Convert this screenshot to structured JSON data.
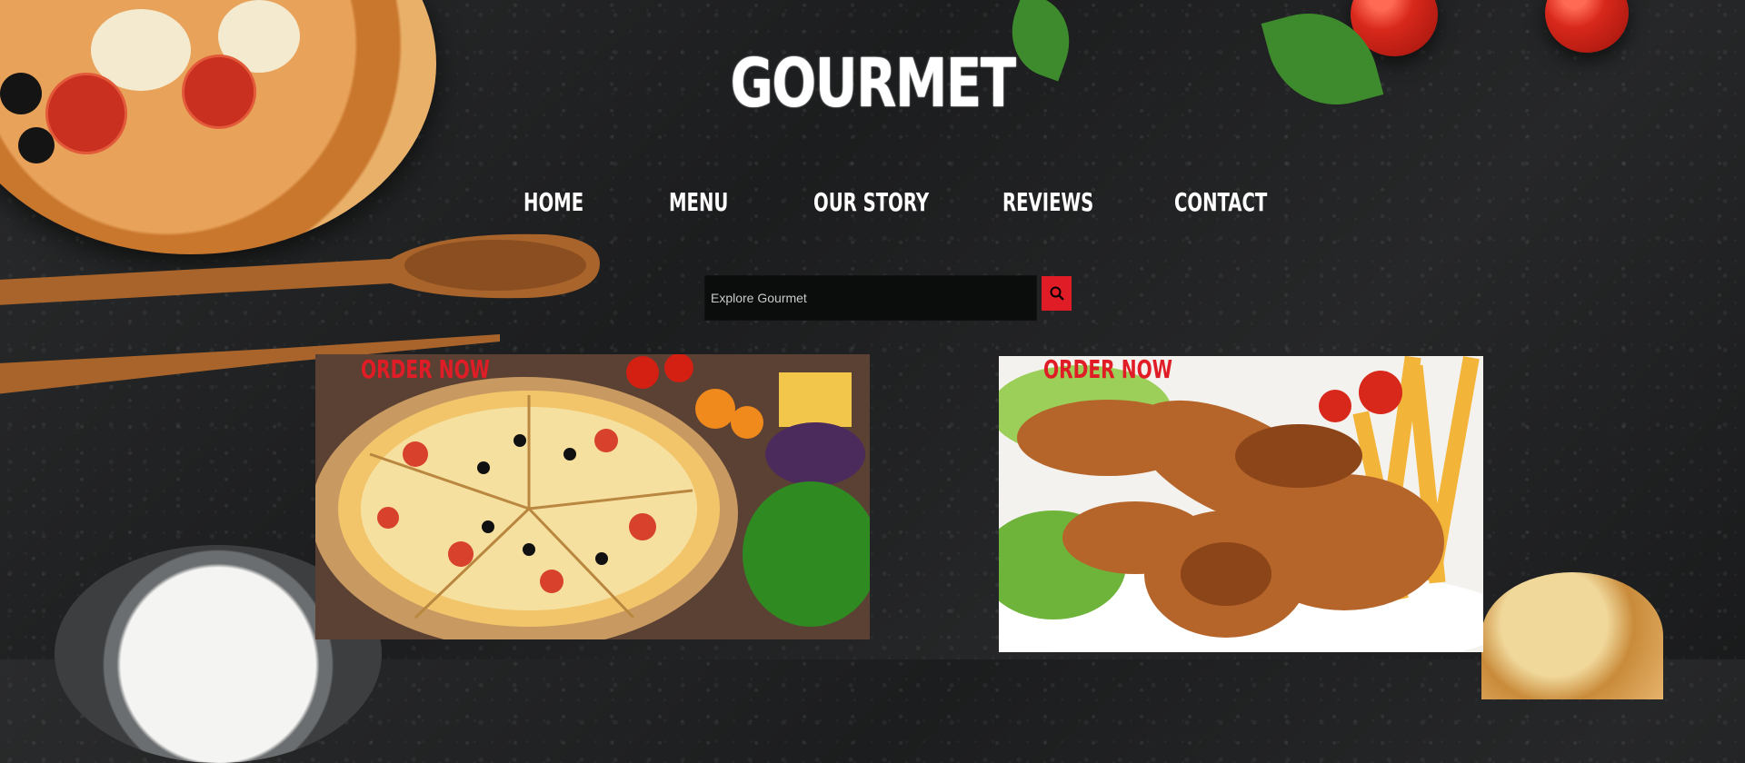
{
  "brand": {
    "name": "GOURMET"
  },
  "nav": {
    "items": [
      {
        "label": "HOME"
      },
      {
        "label": "MENU"
      },
      {
        "label": "OUR STORY"
      },
      {
        "label": "REVIEWS"
      },
      {
        "label": "CONTACT"
      }
    ]
  },
  "search": {
    "placeholder": "Explore Gourmet",
    "button_icon": "search-icon"
  },
  "cards": [
    {
      "cta": "ORDER NOW",
      "image": "pizza-photo"
    },
    {
      "cta": "ORDER NOW",
      "image": "chicken-drumsticks-photo"
    }
  ],
  "colors": {
    "accent": "#e01d26",
    "background": "#222324",
    "text": "#ffffff"
  }
}
